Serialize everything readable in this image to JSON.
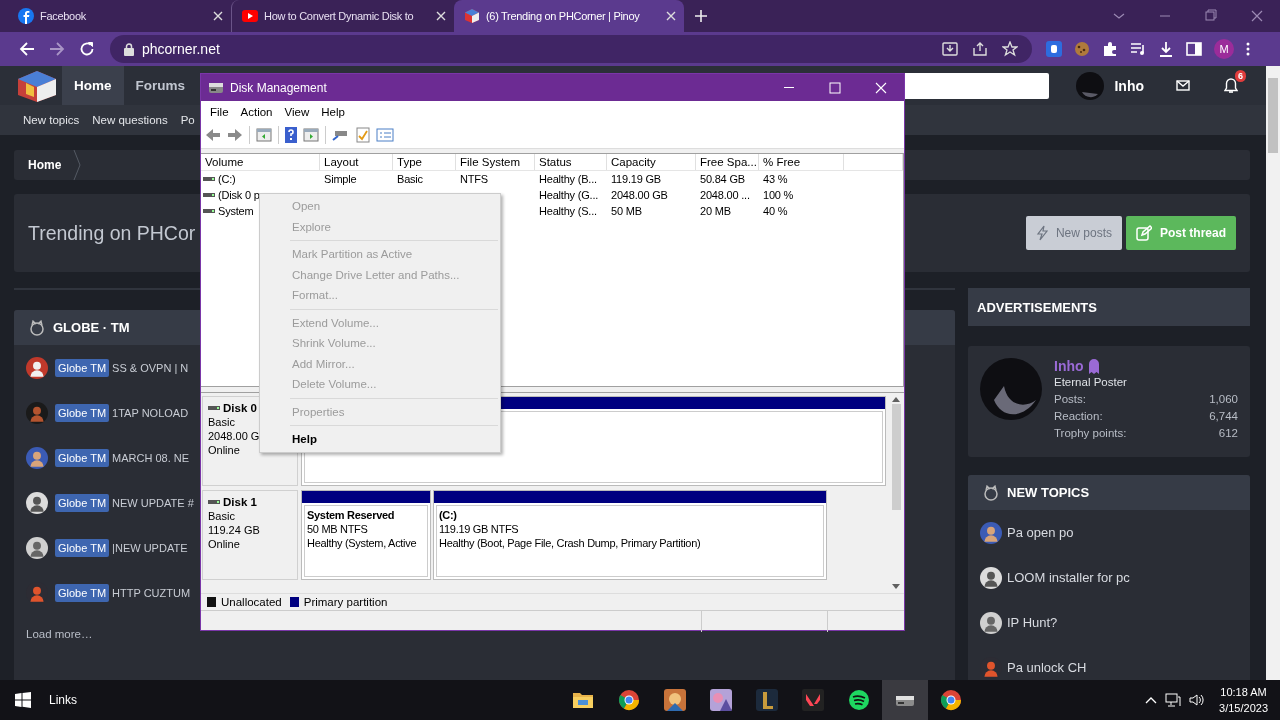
{
  "browser": {
    "tabs": [
      {
        "title": "Facebook",
        "selected": false
      },
      {
        "title": "How to Convert Dynamic Disk to",
        "selected": false
      },
      {
        "title": "(6) Trending on PHCorner | Pinoy",
        "selected": true
      }
    ],
    "address": "phcorner.net",
    "profile_initial": "M"
  },
  "forum": {
    "nav": [
      {
        "label": "Home",
        "selected": true
      },
      {
        "label": "Forums",
        "selected": false
      }
    ],
    "user": "Inho",
    "notification_count": "6",
    "subnav": [
      "New topics",
      "New questions",
      "Po"
    ],
    "breadcrumb": "Home",
    "page_title": "Trending on PHCor",
    "buttons": [
      {
        "label": "New posts",
        "kind": "secondary"
      },
      {
        "label": "Post thread",
        "kind": "primary"
      }
    ],
    "section": {
      "title": "GLOBE · TM",
      "threads": [
        {
          "tag": "Globe TM",
          "title": "SS & OVPN | N"
        },
        {
          "tag": "Globe TM",
          "title": "1TAP NOLOAD"
        },
        {
          "tag": "Globe TM",
          "title": "MARCH 08. NE"
        },
        {
          "tag": "Globe TM",
          "title": "NEW UPDATE #"
        },
        {
          "tag": "Globe TM",
          "title": "|NEW UPDATE"
        },
        {
          "tag": "Globe TM",
          "title": "HTTP CUZTUM"
        }
      ],
      "load_more": "Load more…"
    },
    "sidebar": {
      "ads_title": "ADVERTISEMENTS",
      "profile": {
        "name": "Inho",
        "rank": "Eternal Poster",
        "stats": [
          {
            "label": "Posts:",
            "value": "1,060"
          },
          {
            "label": "Reaction:",
            "value": "6,744"
          },
          {
            "label": "Trophy points:",
            "value": "612"
          }
        ]
      },
      "new_topics": {
        "title": "NEW TOPICS",
        "items": [
          "Pa open po",
          "LOOM installer for pc",
          "IP Hunt?",
          "Pa unlock CH"
        ]
      }
    }
  },
  "disk_window": {
    "title": "Disk Management",
    "menu": [
      "File",
      "Action",
      "View",
      "Help"
    ],
    "columns": [
      "Volume",
      "Layout",
      "Type",
      "File System",
      "Status",
      "Capacity",
      "Free Spa...",
      "% Free"
    ],
    "rows": [
      {
        "cells": [
          "(C:)",
          "Simple",
          "Basic",
          "NTFS",
          "Healthy (B...",
          "119.19 GB",
          "50.84 GB",
          "43 %"
        ]
      },
      {
        "cells": [
          "(Disk 0 p",
          null,
          null,
          null,
          "Healthy (G...",
          "2048.00 GB",
          "2048.00 ...",
          "100 %"
        ]
      },
      {
        "cells": [
          "System",
          null,
          null,
          null,
          "Healthy (S...",
          "50 MB",
          "20 MB",
          "40 %"
        ]
      }
    ],
    "disks": [
      {
        "name": "Disk 0",
        "type": "Basic",
        "size": "2048.00 G",
        "status": "Online",
        "partitions": [
          {
            "kind": "primary"
          }
        ]
      },
      {
        "name": "Disk 1",
        "type": "Basic",
        "size": "119.24 GB",
        "status": "Online",
        "partitions": [
          {
            "kind": "primary",
            "name": "System Reserved",
            "lines": [
              "50 MB NTFS",
              "Healthy (System, Active"
            ]
          },
          {
            "kind": "primary",
            "name": "(C:)",
            "lines": [
              "119.19 GB NTFS",
              "Healthy (Boot, Page File, Crash Dump, Primary Partition)"
            ]
          }
        ]
      }
    ],
    "legend": [
      {
        "label": "Unallocated",
        "color": "#111111"
      },
      {
        "label": "Primary partition",
        "color": "#000080"
      }
    ]
  },
  "context_menu": [
    {
      "kind": "item",
      "label": "Open",
      "disabled": true,
      "default": false
    },
    {
      "kind": "item",
      "label": "Explore",
      "disabled": true,
      "default": false
    },
    {
      "kind": "separator"
    },
    {
      "kind": "item",
      "label": "Mark Partition as Active",
      "disabled": true,
      "default": false
    },
    {
      "kind": "item",
      "label": "Change Drive Letter and Paths...",
      "disabled": true,
      "default": false
    },
    {
      "kind": "item",
      "label": "Format...",
      "disabled": true,
      "default": false
    },
    {
      "kind": "separator"
    },
    {
      "kind": "item",
      "label": "Extend Volume...",
      "disabled": true,
      "default": false
    },
    {
      "kind": "item",
      "label": "Shrink Volume...",
      "disabled": true,
      "default": false
    },
    {
      "kind": "item",
      "label": "Add Mirror...",
      "disabled": true,
      "default": false
    },
    {
      "kind": "item",
      "label": "Delete Volume...",
      "disabled": true,
      "default": false
    },
    {
      "kind": "separator"
    },
    {
      "kind": "item",
      "label": "Properties",
      "disabled": true,
      "default": false
    },
    {
      "kind": "separator"
    },
    {
      "kind": "item",
      "label": "Help",
      "disabled": false,
      "default": true
    }
  ],
  "taskbar": {
    "links": "Links",
    "apps": [
      {
        "selected": false
      },
      {
        "selected": false
      },
      {
        "selected": false
      },
      {
        "selected": false
      },
      {
        "selected": false
      },
      {
        "selected": false
      },
      {
        "selected": false
      },
      {
        "selected": true
      },
      {
        "selected": false
      }
    ],
    "time": "10:18 AM",
    "date": "3/15/2023"
  }
}
